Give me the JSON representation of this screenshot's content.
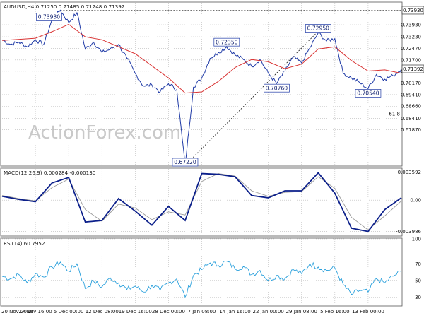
{
  "watermark": "ActionForex.com",
  "colors": {
    "price": "#1f3aa6",
    "ma": "#d93434",
    "macd": "#0b1f8a",
    "signal": "#9a9a9a",
    "rsi": "#2aa0dc",
    "grid": "#b7b7b7",
    "frame": "#555555",
    "box_fill": "#ffffff",
    "box_border": "#1f3aa6",
    "dashed": "#000000"
  },
  "x_labels": [
    "20 Nov 2018",
    "27 Nov 16:00",
    "5 Dec 00:00",
    "12 Dec 08:00",
    "19 Dec 16:00",
    "28 Dec 00:00",
    "7 Jan 08:00",
    "14 Jan 16:00",
    "22 Jan 00:00",
    "29 Jan 08:00",
    "5 Feb 16:00",
    "13 Feb 00:00"
  ],
  "chart_data": [
    {
      "type": "line",
      "title": "AUDUSD,H4  0.71250 0.71485 0.71248 0.71392",
      "series": [
        {
          "role": "price",
          "x": [
            0,
            0.25,
            0.5,
            0.75,
            1,
            1.25,
            1.5,
            1.75,
            2,
            2.25,
            2.5,
            2.75,
            3,
            3.25,
            3.5,
            3.75,
            4,
            4.25,
            4.5,
            4.75,
            5,
            5.25,
            5.5,
            5.75,
            6,
            6.25,
            6.5,
            6.75,
            7,
            7.25,
            7.5,
            7.75,
            8,
            8.25,
            8.5,
            8.75,
            9,
            9.25,
            9.5,
            9.75,
            10,
            10.25,
            10.5,
            10.75,
            11,
            11.25,
            11.5,
            11.75,
            12
          ],
          "values": [
            0.7265,
            0.7245,
            0.7255,
            0.7235,
            0.7265,
            0.7245,
            0.7352,
            0.7393,
            0.734,
            0.7382,
            0.7225,
            0.7255,
            0.721,
            0.7225,
            0.7245,
            0.7185,
            0.712,
            0.7065,
            0.707,
            0.704,
            0.7075,
            0.705,
            0.6722,
            0.706,
            0.71,
            0.7185,
            0.721,
            0.7235,
            0.72,
            0.718,
            0.715,
            0.718,
            0.712,
            0.7076,
            0.713,
            0.719,
            0.7165,
            0.723,
            0.7295,
            0.726,
            0.727,
            0.712,
            0.71,
            0.708,
            0.7054,
            0.7115,
            0.7095,
            0.711,
            0.71392
          ]
        },
        {
          "role": "ma",
          "x": [
            0,
            1,
            1.5,
            2,
            2.5,
            3,
            4,
            5,
            5.5,
            6,
            6.5,
            7,
            7.5,
            8,
            8.5,
            9,
            9.5,
            10,
            10.5,
            11,
            11.5,
            12
          ],
          "values": [
            0.7262,
            0.7272,
            0.73,
            0.7332,
            0.7278,
            0.7265,
            0.7205,
            0.71,
            0.7035,
            0.704,
            0.7085,
            0.7145,
            0.718,
            0.717,
            0.714,
            0.716,
            0.7225,
            0.7235,
            0.7175,
            0.713,
            0.7135,
            0.712
          ]
        }
      ],
      "annotations": [
        {
          "label": "0.73930",
          "x": 1.75,
          "y": 0.7393
        },
        {
          "label": "0.72350",
          "x": 6.75,
          "y": 0.7235
        },
        {
          "label": "0.72950",
          "x": 9.5,
          "y": 0.7295
        },
        {
          "label": "0.70760",
          "x": 8.25,
          "y": 0.7076
        },
        {
          "label": "0.70540",
          "x": 11.0,
          "y": 0.7054
        },
        {
          "label": "0.67220",
          "x": 5.5,
          "y": 0.6722
        }
      ],
      "fib_level": {
        "label": "61.8",
        "value": 0.6932
      },
      "resistance_value": 0.7393,
      "current_value": 0.71392,
      "ylim": [
        0.6722,
        0.7425
      ],
      "yticks": [
        0.6877,
        0.6925,
        0.6978,
        0.7028,
        0.7078,
        0.7129,
        0.7178,
        0.7228,
        0.7278,
        0.733
      ],
      "ytick_labels": [
        "0.67870",
        "0.68410",
        "0.68660",
        "0.69410",
        "0.70170",
        "0.70950",
        "0.71700",
        "0.72470",
        "0.73230",
        "0.73930"
      ],
      "price_tag_label": "0.71392",
      "resistance_tag_label": "0.73930"
    },
    {
      "type": "line",
      "title": "MACD(12,26,9) 0.000284 -0.000130",
      "series": [
        {
          "role": "macd",
          "x": [
            0,
            0.5,
            1,
            1.5,
            2,
            2.5,
            3,
            3.5,
            4,
            4.5,
            5,
            5.5,
            6,
            6.5,
            7,
            7.5,
            8,
            8.5,
            9,
            9.5,
            10,
            10.5,
            11,
            11.5,
            12
          ],
          "values": [
            0.0005,
            0.0001,
            -0.0002,
            0.0022,
            0.0029,
            -0.0028,
            -0.0026,
            0.0002,
            -0.0014,
            -0.0032,
            -0.0008,
            -0.0026,
            0.0034,
            0.0033,
            0.003,
            0.0006,
            0.0003,
            0.0012,
            0.0012,
            0.0035,
            0.0009,
            -0.0036,
            -0.004,
            -0.0012,
            0.0003
          ]
        },
        {
          "role": "signal",
          "x": [
            0,
            0.5,
            1,
            1.5,
            2,
            2.5,
            3,
            3.5,
            4,
            4.5,
            5,
            5.5,
            6,
            6.5,
            7,
            7.5,
            8,
            8.5,
            9,
            9.5,
            10,
            10.5,
            11,
            11.5,
            12
          ],
          "values": [
            0.0006,
            0.0002,
            -0.0001,
            0.0016,
            0.0027,
            -0.0012,
            -0.0027,
            -0.0005,
            -0.001,
            -0.0025,
            -0.0015,
            -0.0019,
            0.0024,
            0.0034,
            0.0031,
            0.0012,
            0.0005,
            0.001,
            0.0011,
            0.003,
            0.0015,
            -0.0022,
            -0.0038,
            -0.002,
            -0.0001
          ]
        }
      ],
      "ylim": [
        -0.0045,
        0.004
      ],
      "ytick_values": [
        0.003592,
        0.0,
        -0.003986
      ],
      "ytick_labels": [
        "0.003592",
        "0.00",
        "-0.003986"
      ],
      "trend_line": {
        "x_start": 5.8,
        "x_end": 10.3,
        "value": 0.0036
      }
    },
    {
      "type": "line",
      "title": "RSI(14) 60.7952",
      "series": [
        {
          "role": "rsi",
          "x": [
            0,
            0.25,
            0.5,
            0.75,
            1,
            1.25,
            1.5,
            1.75,
            2,
            2.25,
            2.5,
            2.75,
            3,
            3.25,
            3.5,
            3.75,
            4,
            4.25,
            4.5,
            4.75,
            5,
            5.25,
            5.5,
            5.75,
            6,
            6.25,
            6.5,
            6.75,
            7,
            7.25,
            7.5,
            7.75,
            8,
            8.25,
            8.5,
            8.75,
            9,
            9.25,
            9.5,
            9.75,
            10,
            10.25,
            10.5,
            10.75,
            11,
            11.25,
            11.5,
            11.75,
            12
          ],
          "values": [
            55,
            52,
            57,
            47,
            58,
            54,
            66,
            72,
            61,
            70,
            40,
            49,
            42,
            53,
            47,
            39,
            43,
            36,
            44,
            38,
            47,
            52,
            30,
            56,
            63,
            71,
            68,
            73,
            64,
            67,
            57,
            62,
            50,
            56,
            52,
            63,
            58,
            70,
            66,
            62,
            65,
            45,
            33,
            38,
            36,
            52,
            47,
            55,
            60.8
          ]
        }
      ],
      "ylim": [
        20,
        100
      ],
      "yticks": [
        30,
        50,
        70,
        100
      ],
      "ytick_labels": [
        "30",
        "50",
        "70",
        "100"
      ]
    }
  ]
}
